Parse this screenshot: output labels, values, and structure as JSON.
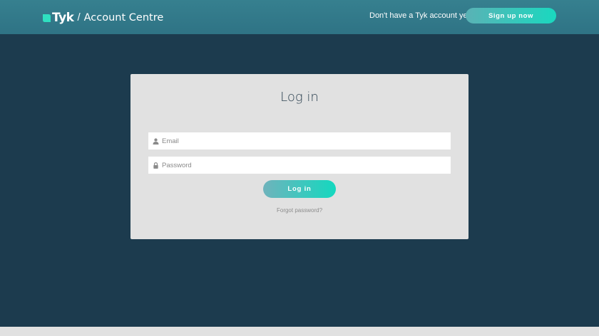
{
  "header": {
    "brand": "Tyk",
    "separator": "/",
    "app_name": "Account Centre",
    "signup_prompt": "Don't have a Tyk account yet ?",
    "signup_button": "Sign up now"
  },
  "login": {
    "title": "Log in",
    "email_placeholder": "Email",
    "email_icon": "user-icon",
    "password_placeholder": "Password",
    "password_icon": "lock-icon",
    "submit_label": "Log in",
    "forgot_link": "Forgot password?"
  },
  "colors": {
    "page_background": "#1c3b4e",
    "header_background": "#36808f",
    "card_background": "#e1e1e1",
    "accent_start": "#5ab2b5",
    "accent_end": "#1ad8bf",
    "title_text": "#2c4150"
  }
}
